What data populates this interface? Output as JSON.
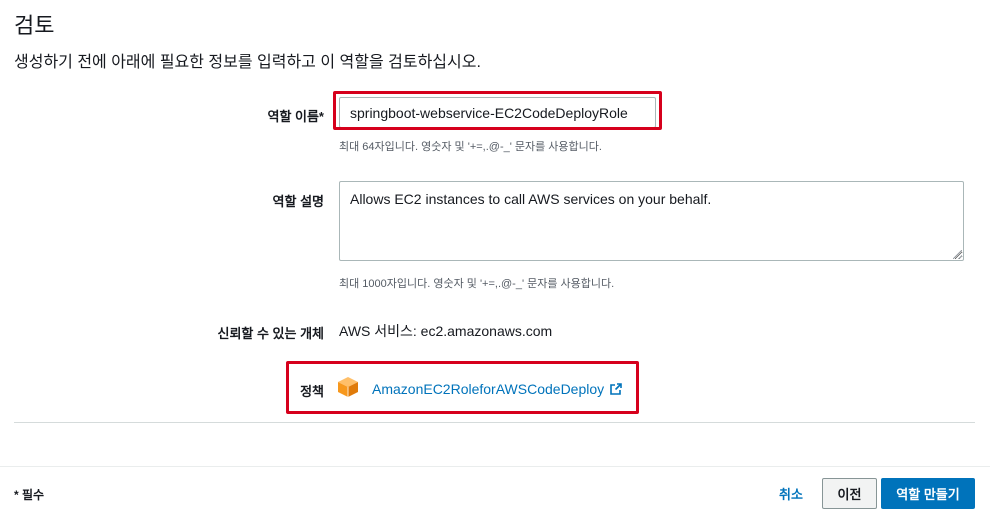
{
  "page": {
    "title": "검토",
    "subtitle": "생성하기 전에 아래에 필요한 정보를 입력하고 이 역할을 검토하십시오."
  },
  "form": {
    "role_name": {
      "label": "역할 이름*",
      "value": "springboot-webservice-EC2CodeDeployRole",
      "hint": "최대 64자입니다. 영숫자 및 '+=,.@-_' 문자를 사용합니다."
    },
    "role_description": {
      "label": "역할 설명",
      "value": "Allows EC2 instances to call AWS services on your behalf.",
      "hint": "최대 1000자입니다. 영숫자 및 '+=,.@-_' 문자를 사용합니다."
    },
    "trusted_entity": {
      "label": "신뢰할 수 있는 개체",
      "value": "AWS 서비스: ec2.amazonaws.com"
    },
    "policy": {
      "label": "정책",
      "link_text": "AmazonEC2RoleforAWSCodeDeploy",
      "icon": "aws-policy-box-icon"
    }
  },
  "footer": {
    "required_note": "* 필수",
    "cancel_label": "취소",
    "previous_label": "이전",
    "create_label": "역할 만들기"
  },
  "colors": {
    "highlight_border": "#d6001c",
    "link": "#0073bb",
    "primary_button": "#0073bb",
    "policy_icon": "#f7981d"
  }
}
